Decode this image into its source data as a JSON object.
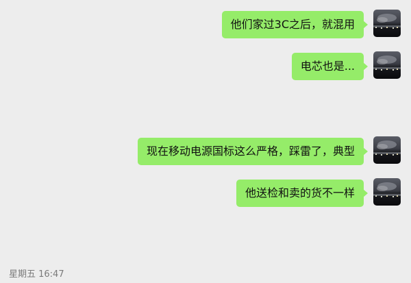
{
  "messages": [
    {
      "text": "他们家过3C之后，就混用"
    },
    {
      "text": "电芯也是..."
    },
    {
      "text": "现在移动电源国标这么严格，踩雷了，典型"
    },
    {
      "text": "他送检和卖的货不一样"
    }
  ],
  "footer": {
    "timestamp": "星期五 16:47"
  },
  "colors": {
    "bubble": "#95ec69",
    "background": "#ededed",
    "avatar_sky": "#5a5d66",
    "avatar_ground": "#0a0a0d"
  },
  "icons": {
    "avatar": "avatar-icon"
  }
}
